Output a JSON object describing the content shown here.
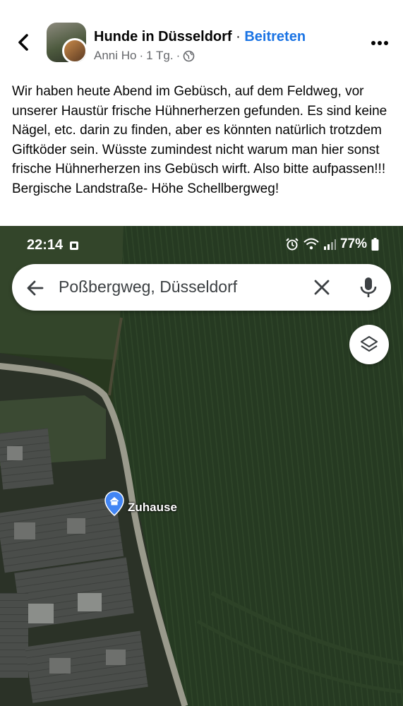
{
  "header": {
    "group_name": "Hunde in Düsseldorf",
    "separator": " · ",
    "join_label": "Beitreten",
    "author": "Anni Ho",
    "time_ago": "1 Tg.",
    "meta_sep": "·",
    "back_icon": "chevron-left-icon",
    "more_icon": "more-horizontal-icon",
    "privacy_icon": "globe-icon"
  },
  "post": {
    "text": "Wir haben heute Abend im Gebüsch, auf dem Feldweg, vor unserer Haustür frische Hühnerherzen gefunden. Es sind keine Nägel, etc. darin zu finden, aber es könnten natürlich trotzdem Giftköder sein. Wüsste zumindest nicht warum man hier sonst frische Hühnerherzen ins Gebüsch wirft. Also bitte aufpassen!!! Bergische Landstraße- Höhe Schellbergweg!"
  },
  "screenshot": {
    "status_time": "22:14",
    "battery": "77%",
    "search_value": "Poßbergweg, Düsseldorf",
    "pin_label": "Zuhause"
  },
  "colors": {
    "accent": "#1b74e4",
    "text": "#050505",
    "muted": "#65676b",
    "pin": "#4285f4"
  }
}
